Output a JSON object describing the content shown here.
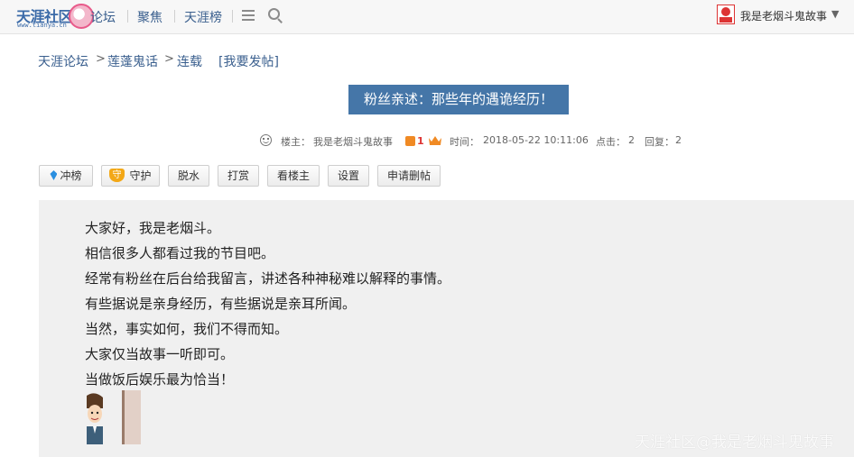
{
  "header": {
    "logo_text": "天涯社区",
    "logo_url_text": "www.tianya.cn",
    "nav": [
      "论坛",
      "聚焦",
      "天涯榜"
    ],
    "user_name": "我是老烟斗鬼故事",
    "caret": "▼"
  },
  "breadcrumb": {
    "items": [
      "天涯论坛",
      "莲蓬鬼话",
      "连载"
    ],
    "post_link": "[我要发帖]"
  },
  "post": {
    "title": "粉丝亲述：那些年的遇诡经历！",
    "owner_label": "楼主：",
    "owner_name": "我是老烟斗鬼故事",
    "level": "1",
    "time_label": "时间：",
    "time": "2018-05-22 10:11:06",
    "clicks_label": "点击：",
    "clicks": "2",
    "replies_label": "回复：",
    "replies": "2"
  },
  "actions": [
    "冲榜",
    "守护",
    "脱水",
    "打赏",
    "看楼主",
    "设置",
    "申请删帖"
  ],
  "content": {
    "lines": [
      "大家好，我是老烟斗。",
      "相信很多人都看过我的节目吧。",
      "经常有粉丝在后台给我留言，讲述各种神秘难以解释的事情。",
      "有些据说是亲身经历，有些据说是亲耳所闻。",
      "当然，事实如何，我们不得而知。",
      "大家仅当故事一听即可。",
      "当做饭后娱乐最为恰当！"
    ]
  },
  "watermark": "天涯社区@我是老烟斗鬼故事",
  "colors": {
    "link": "#3a5f8e",
    "title_bg": "#4576a8",
    "content_bg": "#f0f0f0"
  }
}
